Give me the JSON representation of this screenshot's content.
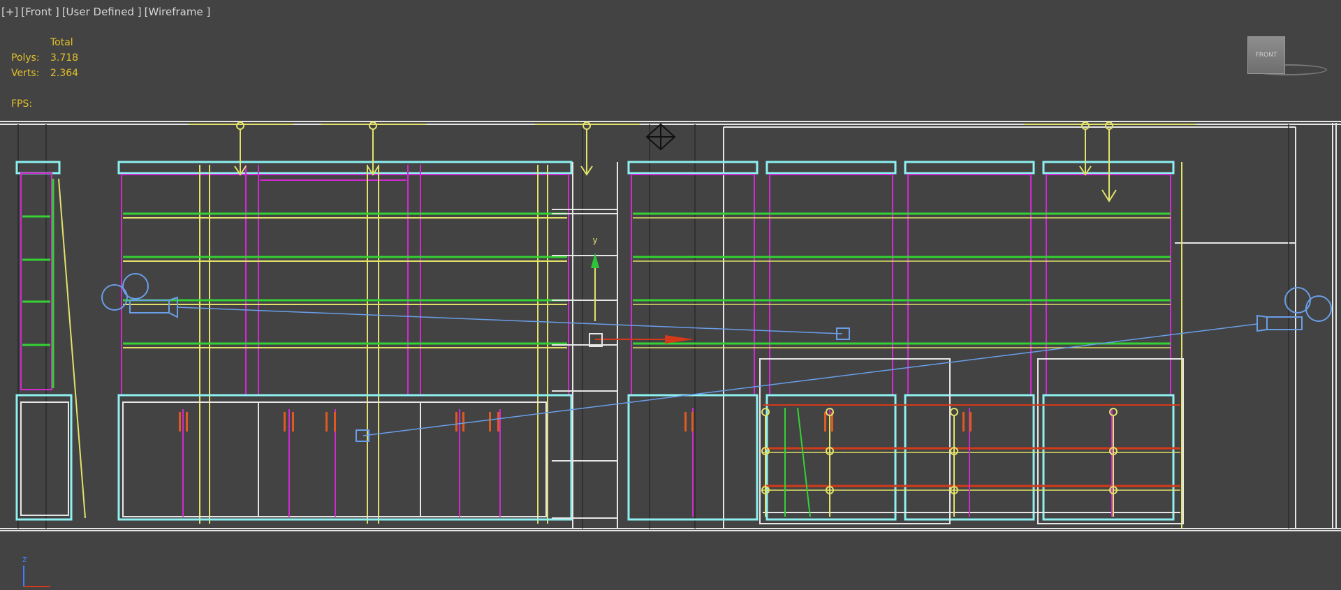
{
  "viewport": {
    "label_parts": [
      "[+]",
      "[Front ]",
      "[User Defined ]",
      "[Wireframe ]"
    ],
    "stats": {
      "header": "Total",
      "polys_label": "Polys:",
      "polys_value": "3.718",
      "verts_label": "Verts:",
      "verts_value": "2.364",
      "fps_label": "FPS:"
    },
    "viewcube_label": "FRONT",
    "axis_labels": {
      "z": "z",
      "y": "y"
    },
    "colors": {
      "background": "#434343",
      "cyan": "#8ef0f0",
      "magenta": "#d02ad0",
      "green": "#34d234",
      "yellow": "#e2e26a",
      "white": "#e6e6e6",
      "blue": "#6a9ee8",
      "red": "#d43a1a",
      "orange": "#e05a20"
    }
  }
}
